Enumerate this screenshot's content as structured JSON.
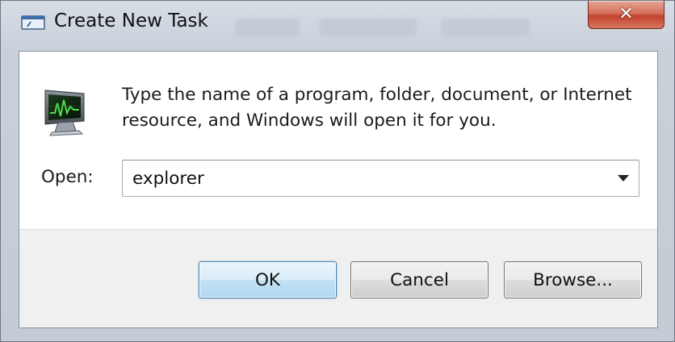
{
  "window": {
    "title": "Create New Task",
    "title_icon": "run-dialog-icon",
    "close_icon": "close-icon",
    "close_glyph": "✕",
    "close_color": "#c94a33"
  },
  "dialog": {
    "program_icon": "task-manager-monitor-icon",
    "instruction": "Type the name of a program, folder, document, or Internet resource, and Windows will open it for you.",
    "open_label": "Open:",
    "open_value": "explorer",
    "dropdown_icon": "chevron-down-icon"
  },
  "buttons": {
    "ok_label": "OK",
    "cancel_label": "Cancel",
    "browse_label": "Browse...",
    "default_accent": "#3c7fb1"
  }
}
